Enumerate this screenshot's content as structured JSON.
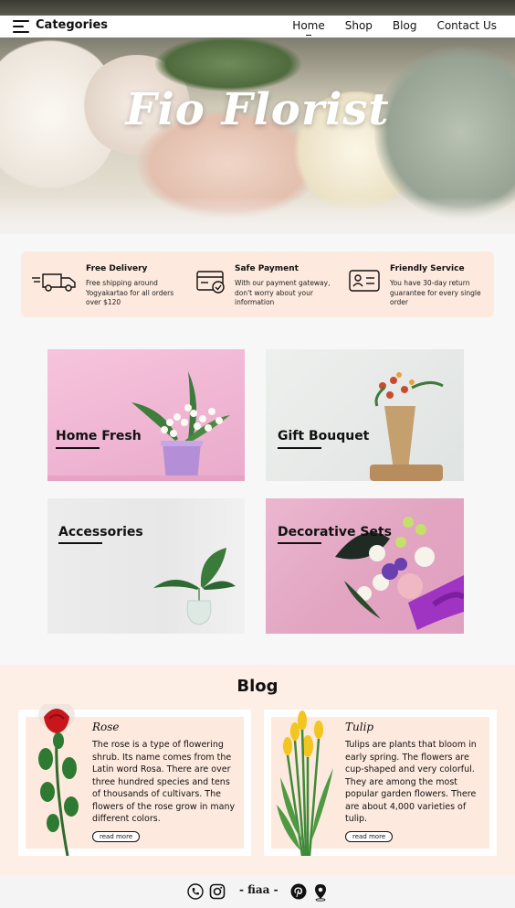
{
  "nav": {
    "brand": "Categories",
    "links": [
      "Home",
      "Shop",
      "Blog",
      "Contact Us"
    ]
  },
  "hero": {
    "title": "Fio Florist"
  },
  "features": [
    {
      "title": "Free Delivery",
      "description": "Free shipping around Yogyakartao for all orders over $120",
      "icon": "delivery-truck-icon"
    },
    {
      "title": "Safe Payment",
      "description": "With our payment gateway, don't worry about your information",
      "icon": "credit-card-icon"
    },
    {
      "title": "Friendly Service",
      "description": "You have 30-day return guarantee for every single order",
      "icon": "id-card-icon"
    }
  ],
  "categories": [
    "Home Fresh",
    "Gift Bouquet",
    "Accessories",
    "Decorative Sets"
  ],
  "blog": {
    "title": "Blog",
    "posts": [
      {
        "title": "Rose",
        "body": "The rose is a type of flowering shrub. Its name comes from the Latin word Rosa. There are over three hundred species and tens of thousands of cultivars. The flowers of the rose grow in many different colors.",
        "link": "read more"
      },
      {
        "title": "Tulip",
        "body": "Tulips are plants that bloom in early spring. The flowers are cup-shaped and very colorful. They are among the most popular garden flowers. There are about 4,000 varieties of tulip.",
        "link": "read more"
      }
    ]
  },
  "footer": {
    "brand": "- fiaa -"
  },
  "colors": {
    "accent_bg": "#fde9dd",
    "blog_bg": "#fdeee6",
    "text": "#111111"
  }
}
